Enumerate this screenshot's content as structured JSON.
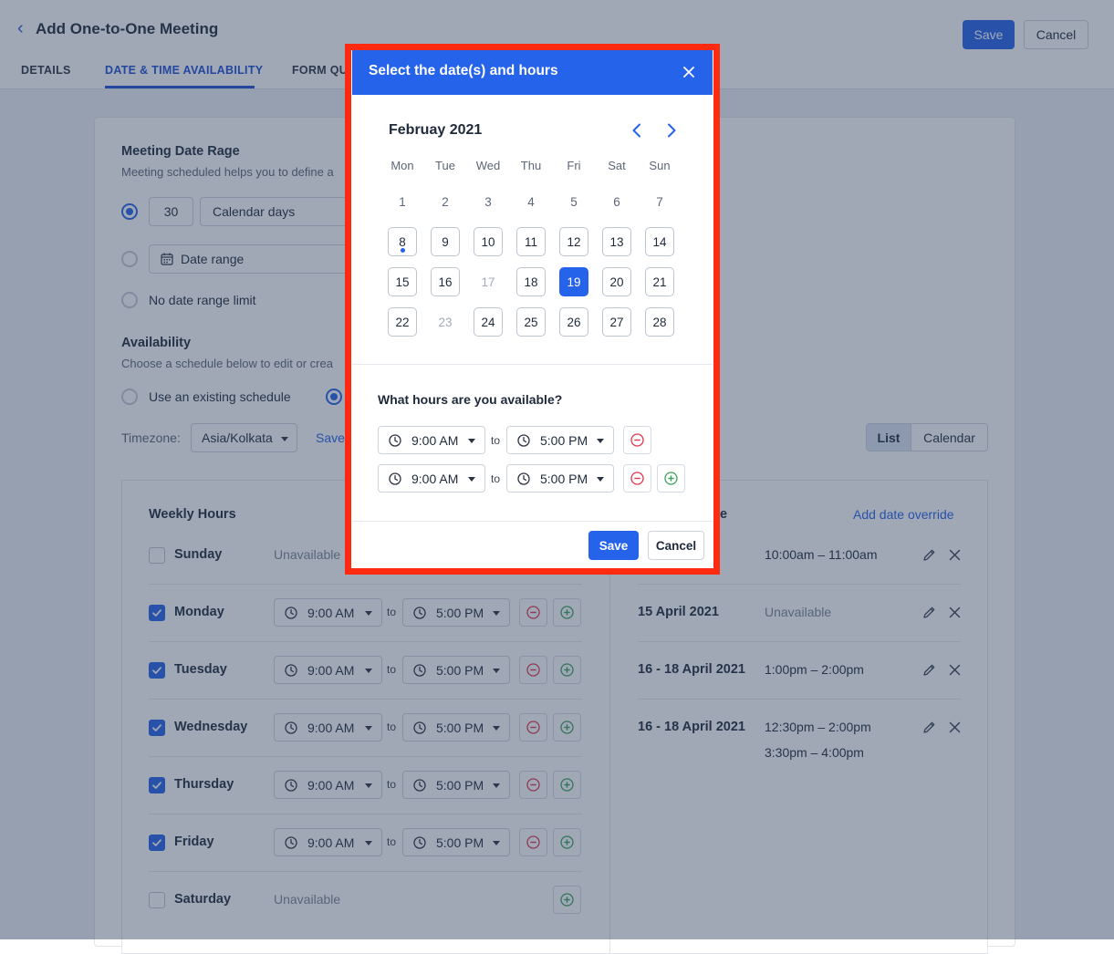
{
  "header": {
    "title": "Add One-to-One Meeting",
    "save_label": "Save",
    "cancel_label": "Cancel",
    "tabs": [
      {
        "label": "DETAILS"
      },
      {
        "label": "DATE & TIME AVAILABILITY"
      },
      {
        "label": "FORM QU"
      }
    ]
  },
  "date_range": {
    "heading": "Meeting Date Rage",
    "description": "Meeting scheduled helps you to define a",
    "days_value": "30",
    "days_unit": "Calendar days",
    "date_range_label": "Date range",
    "no_limit_label": "No date range limit"
  },
  "availability": {
    "heading": "Availability",
    "description": "Choose a schedule below to edit or crea",
    "existing_label": "Use an existing schedule",
    "timezone_label": "Timezone:",
    "timezone_value": "Asia/Kolkata",
    "save_link": "Save",
    "view_list": "List",
    "view_calendar": "Calendar"
  },
  "weekly": {
    "heading": "Weekly Hours",
    "to": "to",
    "days": [
      {
        "name": "Sunday",
        "checked": false,
        "status": "Unavailable"
      },
      {
        "name": "Monday",
        "checked": true,
        "from": "9:00 AM",
        "until": "5:00 PM"
      },
      {
        "name": "Tuesday",
        "checked": true,
        "from": "9:00 AM",
        "until": "5:00 PM"
      },
      {
        "name": "Wednesday",
        "checked": true,
        "from": "9:00 AM",
        "until": "5:00 PM"
      },
      {
        "name": "Thursday",
        "checked": true,
        "from": "9:00 AM",
        "until": "5:00 PM"
      },
      {
        "name": "Friday",
        "checked": true,
        "from": "9:00 AM",
        "until": "5:00 PM"
      },
      {
        "name": "Saturday",
        "checked": false,
        "status": "Unavailable"
      }
    ]
  },
  "overrides": {
    "heading_tail": "e",
    "add_link": "Add date override",
    "rows": [
      {
        "date": "",
        "time": "10:00am – 11:00am"
      },
      {
        "date": "15 April 2021",
        "time": "Unavailable"
      },
      {
        "date": "16 - 18 April 2021",
        "time": "1:00pm – 2:00pm"
      },
      {
        "date": "16 - 18 April 2021",
        "time": "12:30pm – 2:00pm",
        "time2": "3:30pm – 4:00pm"
      }
    ]
  },
  "modal": {
    "title": "Select the date(s) and hours",
    "month": "Februay 2021",
    "weekdays": [
      "Mon",
      "Tue",
      "Wed",
      "Thu",
      "Fri",
      "Sat",
      "Sun"
    ],
    "weeks": [
      [
        {
          "d": "1",
          "s": "plain"
        },
        {
          "d": "2",
          "s": "plain"
        },
        {
          "d": "3",
          "s": "plain"
        },
        {
          "d": "4",
          "s": "plain"
        },
        {
          "d": "5",
          "s": "plain"
        },
        {
          "d": "6",
          "s": "plain"
        },
        {
          "d": "7",
          "s": "plain"
        }
      ],
      [
        {
          "d": "8",
          "s": "today"
        },
        {
          "d": "9",
          "s": "box"
        },
        {
          "d": "10",
          "s": "box"
        },
        {
          "d": "11",
          "s": "box"
        },
        {
          "d": "12",
          "s": "box"
        },
        {
          "d": "13",
          "s": "box"
        },
        {
          "d": "14",
          "s": "box"
        }
      ],
      [
        {
          "d": "15",
          "s": "box"
        },
        {
          "d": "16",
          "s": "box"
        },
        {
          "d": "17",
          "s": "disabled"
        },
        {
          "d": "18",
          "s": "box"
        },
        {
          "d": "19",
          "s": "selected"
        },
        {
          "d": "20",
          "s": "box"
        },
        {
          "d": "21",
          "s": "box"
        }
      ],
      [
        {
          "d": "22",
          "s": "box"
        },
        {
          "d": "23",
          "s": "disabled"
        },
        {
          "d": "24",
          "s": "box"
        },
        {
          "d": "25",
          "s": "box"
        },
        {
          "d": "26",
          "s": "box"
        },
        {
          "d": "27",
          "s": "box"
        },
        {
          "d": "28",
          "s": "box"
        }
      ]
    ],
    "hours_question": "What hours are you available?",
    "to": "to",
    "hours": [
      {
        "from": "9:00 AM",
        "until": "5:00 PM"
      },
      {
        "from": "9:00 AM",
        "until": "5:00 PM"
      }
    ],
    "save_label": "Save",
    "cancel_label": "Cancel"
  },
  "colors": {
    "accent": "#2563eb",
    "highlight": "#ff2a10",
    "remove": "#e0364b",
    "add": "#3aa15a"
  }
}
